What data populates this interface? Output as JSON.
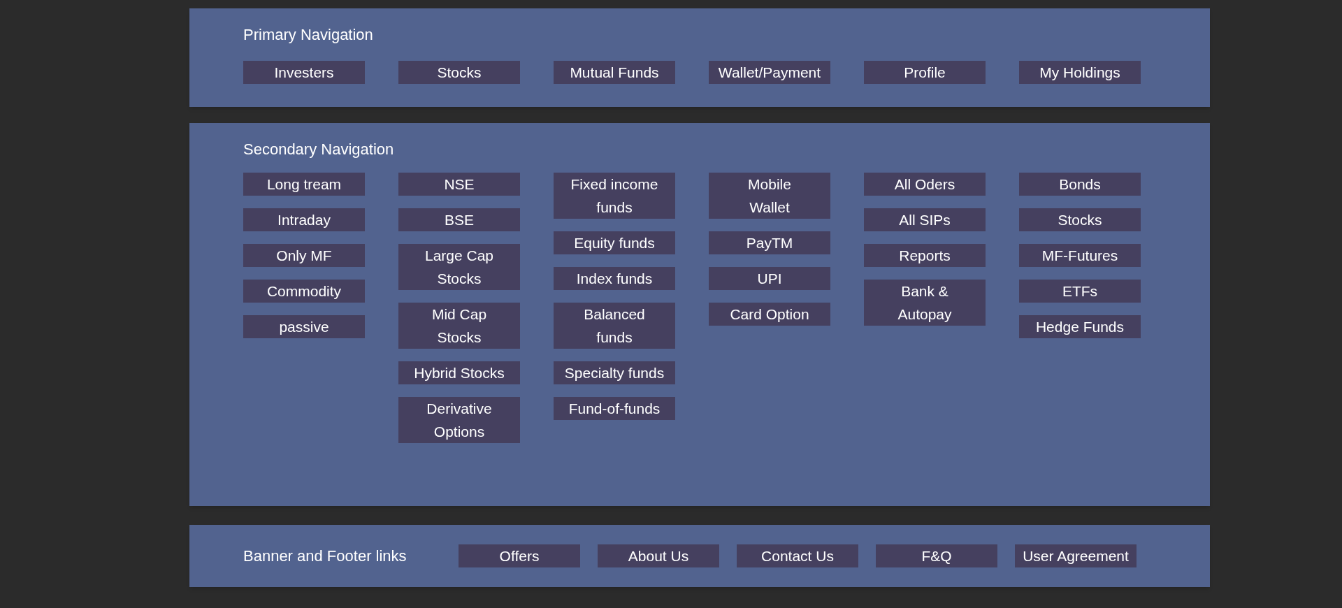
{
  "primary_navigation": {
    "title": "Primary Navigation",
    "items": [
      "Investers",
      "Stocks",
      "Mutual Funds",
      "Wallet/Payment",
      "Profile",
      "My Holdings"
    ]
  },
  "secondary_navigation": {
    "title": "Secondary Navigation",
    "columns": [
      [
        "Long tream",
        "Intraday",
        "Only MF",
        "Commodity",
        "passive"
      ],
      [
        "NSE",
        "BSE",
        "Large Cap\nStocks",
        "Mid Cap\nStocks",
        "Hybrid Stocks",
        "Derivative\nOptions"
      ],
      [
        "Fixed income\nfunds",
        "Equity funds",
        "Index funds",
        "Balanced\nfunds",
        "Specialty funds",
        "Fund-of-funds"
      ],
      [
        "Mobile\nWallet",
        "PayTM",
        "UPI",
        "Card Option"
      ],
      [
        "All Oders",
        "All SIPs",
        "Reports",
        "Bank &\nAutopay"
      ],
      [
        "Bonds",
        "Stocks",
        "MF-Futures",
        "ETFs",
        "Hedge Funds"
      ]
    ]
  },
  "footer": {
    "title": "Banner and Footer links",
    "links": [
      "Offers",
      "About Us",
      "Contact Us",
      "F&Q",
      "User Agreement"
    ]
  }
}
